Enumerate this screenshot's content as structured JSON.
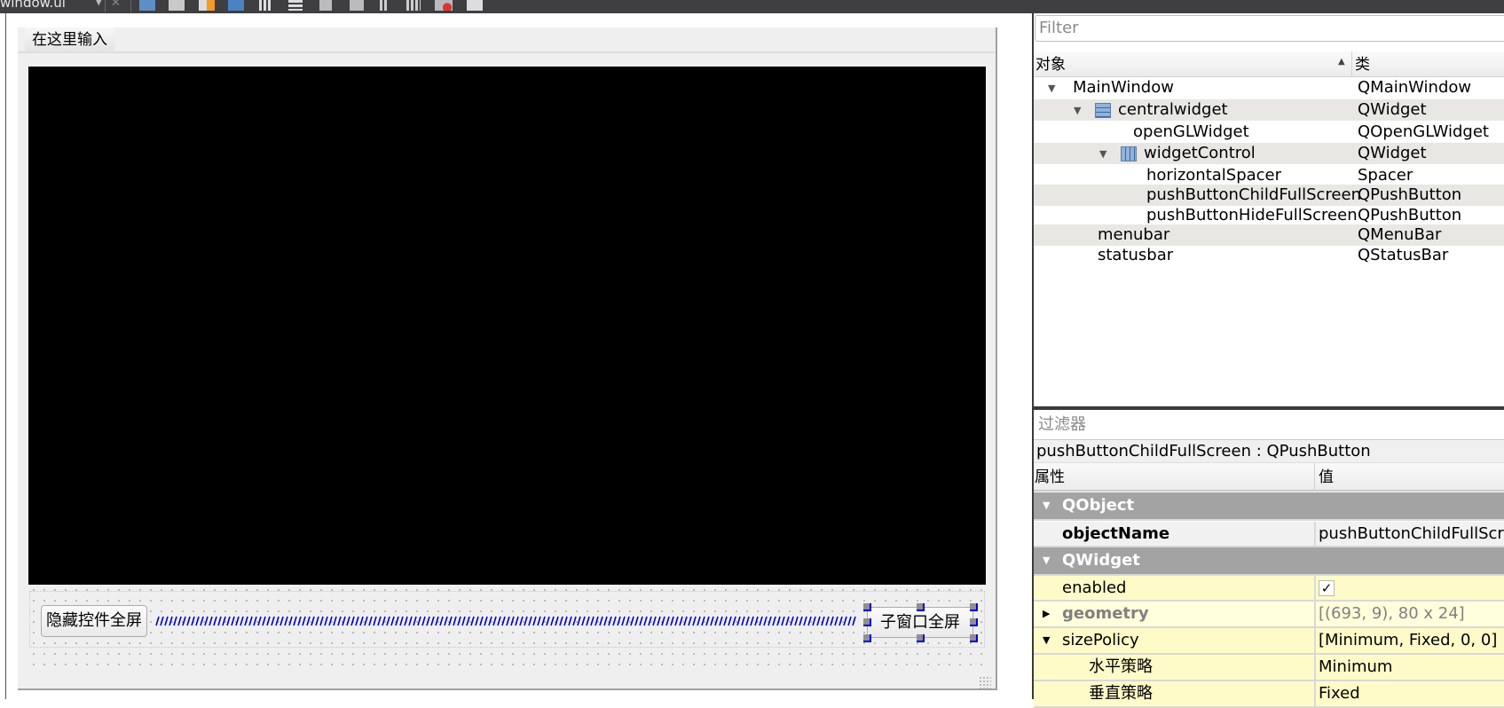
{
  "toolbar": {
    "file_name": "window.ui",
    "icons": [
      "edit-widgets-icon",
      "edit-signals-icon",
      "edit-buddies-icon",
      "edit-tab-order-icon",
      "layout-horizontal-icon",
      "layout-vertical-icon",
      "layout-splitter-horizontal-icon",
      "layout-splitter-vertical-icon",
      "layout-form-icon",
      "layout-grid-icon",
      "break-layout-icon",
      "adjust-size-icon"
    ]
  },
  "form": {
    "menubar_placeholder": "在这里输入",
    "buttons": {
      "hide_fullscreen": "隐藏控件全屏",
      "child_fullscreen": "子窗口全屏"
    }
  },
  "object_inspector": {
    "filter_placeholder": "Filter",
    "columns": {
      "object": "对象",
      "class": "类"
    },
    "rows": [
      {
        "name": "MainWindow",
        "class": "QMainWindow",
        "depth": 0,
        "expanded": true,
        "icon": null
      },
      {
        "name": "centralwidget",
        "class": "QWidget",
        "depth": 1,
        "expanded": true,
        "icon": "vertical-layout-icon"
      },
      {
        "name": "openGLWidget",
        "class": "QOpenGLWidget",
        "depth": 2,
        "expanded": null,
        "icon": null
      },
      {
        "name": "widgetControl",
        "class": "QWidget",
        "depth": 2,
        "expanded": true,
        "icon": "horizontal-layout-icon"
      },
      {
        "name": "horizontalSpacer",
        "class": "Spacer",
        "depth": 3,
        "expanded": null,
        "icon": null
      },
      {
        "name": "pushButtonChildFullScreen",
        "class": "QPushButton",
        "depth": 3,
        "expanded": null,
        "icon": null
      },
      {
        "name": "pushButtonHideFullScreen",
        "class": "QPushButton",
        "depth": 3,
        "expanded": null,
        "icon": null
      },
      {
        "name": "menubar",
        "class": "QMenuBar",
        "depth": 1,
        "expanded": null,
        "icon": null
      },
      {
        "name": "statusbar",
        "class": "QStatusBar",
        "depth": 1,
        "expanded": null,
        "icon": null
      }
    ]
  },
  "property_editor": {
    "filter_placeholder": "过滤器",
    "selected_object": "pushButtonChildFullScreen : QPushButton",
    "columns": {
      "property": "属性",
      "value": "值"
    },
    "rows": [
      {
        "type": "group",
        "name": "QObject"
      },
      {
        "type": "prop",
        "name": "objectName",
        "value": "pushButtonChildFullScreen",
        "bold": true
      },
      {
        "type": "group",
        "name": "QWidget"
      },
      {
        "type": "prop",
        "name": "enabled",
        "value": "✓",
        "checkbox": true
      },
      {
        "type": "prop",
        "name": "geometry",
        "value": "[(693, 9), 80 x 24]",
        "collapsed": true
      },
      {
        "type": "prop",
        "name": "sizePolicy",
        "value": "[Minimum, Fixed, 0, 0]",
        "expanded": true
      },
      {
        "type": "sub",
        "name": "水平策略",
        "value": "Minimum"
      },
      {
        "type": "sub",
        "name": "垂直策略",
        "value": "Fixed"
      }
    ]
  }
}
